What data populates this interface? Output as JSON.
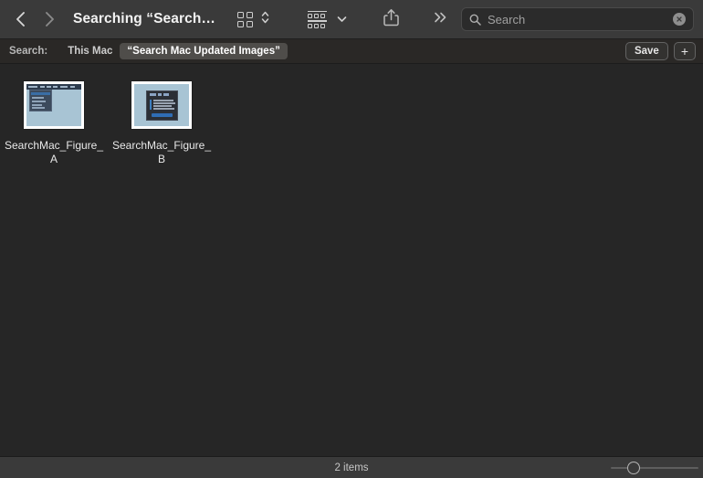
{
  "window": {
    "title": "Searching “Search…",
    "background_color": "#262626",
    "toolbar_color": "#3a3a3a",
    "scopebar_color": "#2a2826"
  },
  "toolbar": {
    "back_icon": "chevron-left-icon",
    "forward_icon": "chevron-right-icon",
    "view_icon": "icon-view-grid-icon",
    "view_stepper_icon": "chevron-up-down-icon",
    "group_icon": "group-by-icon",
    "group_chevron_icon": "chevron-down-icon",
    "share_icon": "share-icon",
    "more_icon": "double-chevron-right-icon"
  },
  "search": {
    "placeholder": "Search",
    "value": "",
    "search_icon": "magnifier-icon",
    "clear_icon": "clear-circle-icon"
  },
  "scope": {
    "label": "Search:",
    "options": [
      {
        "label": "This Mac",
        "selected": false
      },
      {
        "label": "“Search Mac Updated Images”",
        "selected": true
      }
    ],
    "save_label": "Save",
    "add_label": "+"
  },
  "files": [
    {
      "name": "SearchMac_Figure_A",
      "thumb": "figure-a"
    },
    {
      "name": "SearchMac_Figure_B",
      "thumb": "figure-b"
    }
  ],
  "status": {
    "item_count_label": "2 items",
    "zoom_value": 19
  }
}
